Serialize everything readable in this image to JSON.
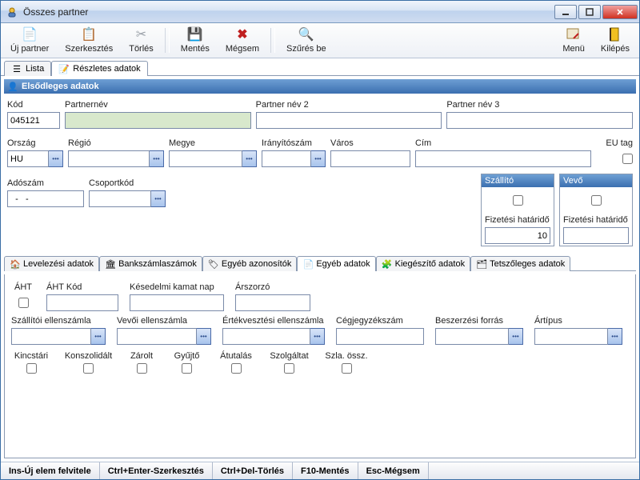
{
  "window": {
    "title": "Összes partner"
  },
  "toolbar": {
    "newpartner": "Új partner",
    "edit": "Szerkesztés",
    "delete": "Törlés",
    "save": "Mentés",
    "cancel": "Mégsem",
    "filter": "Szűrés be",
    "menu": "Menü",
    "exit": "Kilépés"
  },
  "tabs": {
    "list": "Lista",
    "detail": "Részletes adatok"
  },
  "section": {
    "primary": "Elsődleges adatok"
  },
  "labels": {
    "code": "Kód",
    "partnername": "Partnernév",
    "partnername2": "Partner név 2",
    "partnername3": "Partner név 3",
    "country": "Ország",
    "region": "Régió",
    "county": "Megye",
    "zip": "Irányítószám",
    "city": "Város",
    "address": "Cím",
    "eutag": "EU tag",
    "tax": "Adószám",
    "groupcode": "Csoportkód",
    "supplier": "Szállító",
    "customer": "Vevő",
    "paydue": "Fizetési határidő"
  },
  "values": {
    "code": "045121",
    "country": "HU",
    "tax": "  -   -",
    "paydue_supplier": "10",
    "paydue_customer": ""
  },
  "subtabs": {
    "mail": "Levelezési adatok",
    "bank": "Bankszámlaszámok",
    "otherid": "Egyéb azonosítók",
    "otherdata": "Egyéb adatok",
    "extra": "Kiegészítő adatok",
    "custom": "Tetszőleges adatok"
  },
  "other": {
    "aht": "ÁHT",
    "ahtcode": "ÁHT Kód",
    "latedays": "Késedelmi kamat nap",
    "multiplier": "Árszorzó",
    "supcounter": "Szállítói ellenszámla",
    "custcounter": "Vevői ellenszámla",
    "deprec": "Értékvesztési ellenszámla",
    "regno": "Cégjegyzékszám",
    "procsrc": "Beszerzési forrás",
    "pricetype": "Ártípus",
    "treasury": "Kincstári",
    "consolidated": "Konszolidált",
    "locked": "Zárolt",
    "collector": "Gyűjtő",
    "transfer": "Átutalás",
    "service": "Szolgáltat",
    "invsum": "Szla. össz."
  },
  "status": {
    "ins": "Ins-Új elem felvitele",
    "ctrlenter": "Ctrl+Enter-Szerkesztés",
    "ctrldel": "Ctrl+Del-Törlés",
    "f10": "F10-Mentés",
    "esc": "Esc-Mégsem"
  }
}
